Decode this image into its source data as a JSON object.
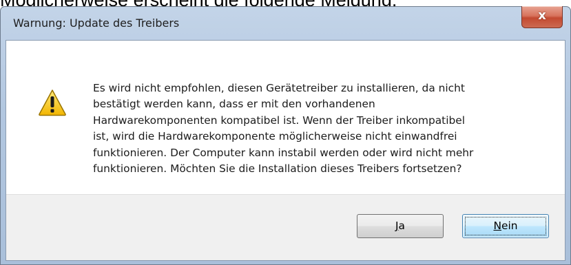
{
  "page_heading": "Möglicherweise erscheint die folgende Meldung:",
  "dialog": {
    "title": "Warnung: Update des Treibers",
    "close_glyph": "x",
    "icon": "warning-triangle-icon",
    "message": "Es wird nicht empfohlen, diesen Gerätetreiber zu installieren, da nicht\nbestätigt werden kann, dass er mit den vorhandenen\nHardwarekomponenten kompatibel ist.  Wenn der Treiber inkompatibel\nist, wird die Hardwarekomponente möglicherweise nicht einwandfrei\nfunktionieren. Der Computer kann instabil werden oder wird nicht mehr\nfunktionieren.  Möchten Sie die Installation dieses Treibers fortsetzen?",
    "buttons": {
      "yes_mnemonic": "J",
      "yes_rest": "a",
      "no_mnemonic": "N",
      "no_rest": "ein"
    }
  },
  "colors": {
    "title_bar": "#b2c7e0",
    "close_button": "#c34a31",
    "default_button_border": "#3c7fb1"
  }
}
